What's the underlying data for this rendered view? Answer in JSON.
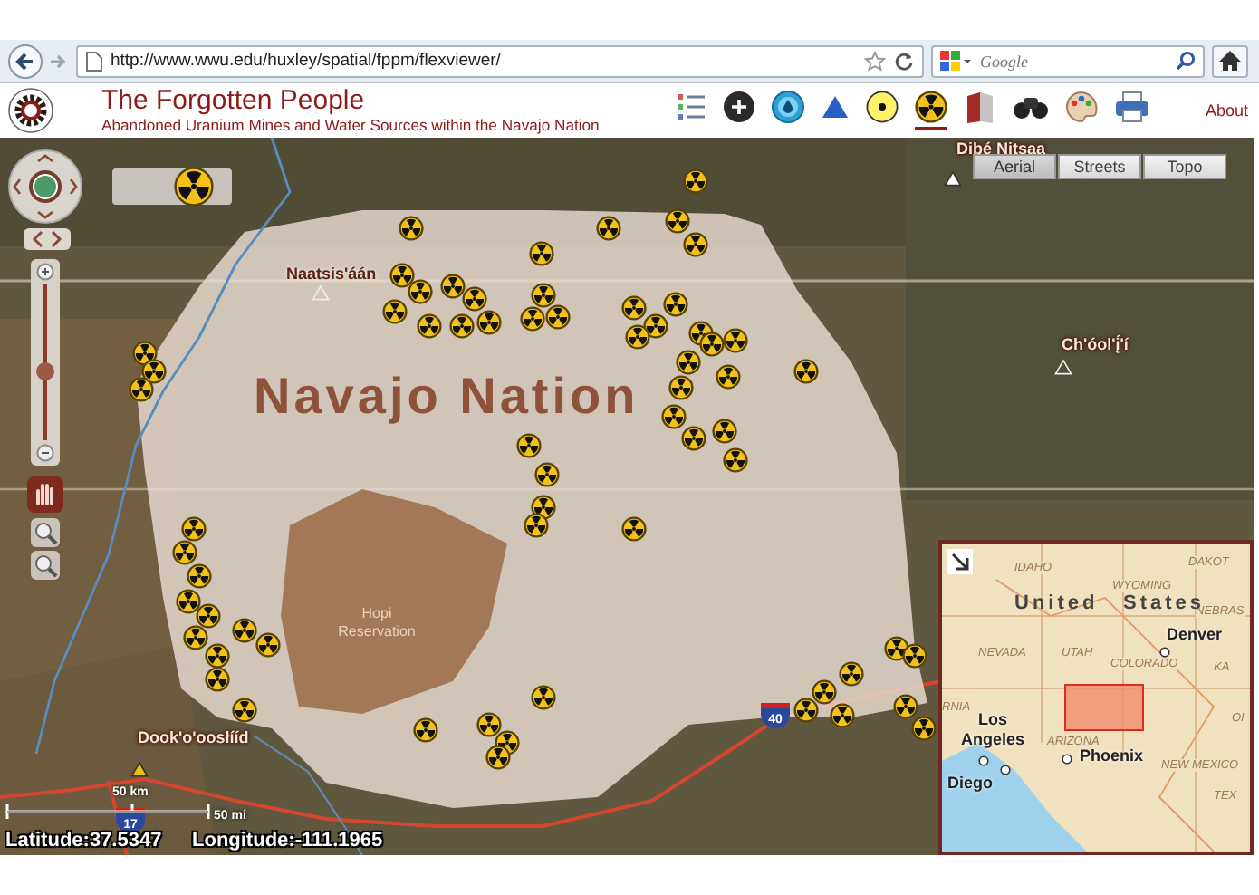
{
  "browser": {
    "url": "http://www.wwu.edu/huxley/spatial/fppm/flexviewer/",
    "search_placeholder": "Google"
  },
  "header": {
    "title": "The Forgotten People",
    "subtitle": "Abandoned Uranium Mines and Water Sources within the Navajo Nation",
    "about": "About"
  },
  "tools": [
    {
      "kind": "legend",
      "selected": false
    },
    {
      "kind": "add",
      "selected": false
    },
    {
      "kind": "water",
      "selected": false
    },
    {
      "kind": "triangle",
      "selected": false
    },
    {
      "kind": "spot",
      "selected": false
    },
    {
      "kind": "mine",
      "selected": true
    },
    {
      "kind": "book",
      "selected": false
    },
    {
      "kind": "binoculars",
      "selected": false
    },
    {
      "kind": "palette",
      "selected": false
    },
    {
      "kind": "print",
      "selected": false
    }
  ],
  "basemaps": [
    {
      "label": "Aerial",
      "selected": true
    },
    {
      "label": "Streets",
      "selected": false
    },
    {
      "label": "Topo",
      "selected": false
    }
  ],
  "zoom": {
    "level": 0.44
  },
  "map": {
    "region_label": "Navajo Nation",
    "reservation_label": "Hopi Reservation",
    "highway_shields": [
      "40",
      "17"
    ],
    "places": [
      {
        "name": "Dibé Nitsaa"
      },
      {
        "name": "Naatsis'áán"
      },
      {
        "name": "Ch'óol'į́'í"
      },
      {
        "name": "Dook'o'oosłííd"
      }
    ]
  },
  "scale": {
    "km": "50 km",
    "mi": "50 mi"
  },
  "coordinates": {
    "latitude": "Latitude:37.5347",
    "longitude": "Longitude:-111.1965"
  },
  "overview": {
    "country": [
      "United",
      "States"
    ],
    "states": [
      "IDAHO",
      "WYOMING",
      "DAKOT",
      "NEBRAS",
      "NEVADA",
      "UTAH",
      "COLORADO",
      "KA",
      "RNIA",
      "OI",
      "ARIZONA",
      "NEW MEXICO",
      "TEX"
    ],
    "cities": [
      "Denver",
      "Los Angeles",
      "Phoenix",
      "Diego"
    ]
  }
}
